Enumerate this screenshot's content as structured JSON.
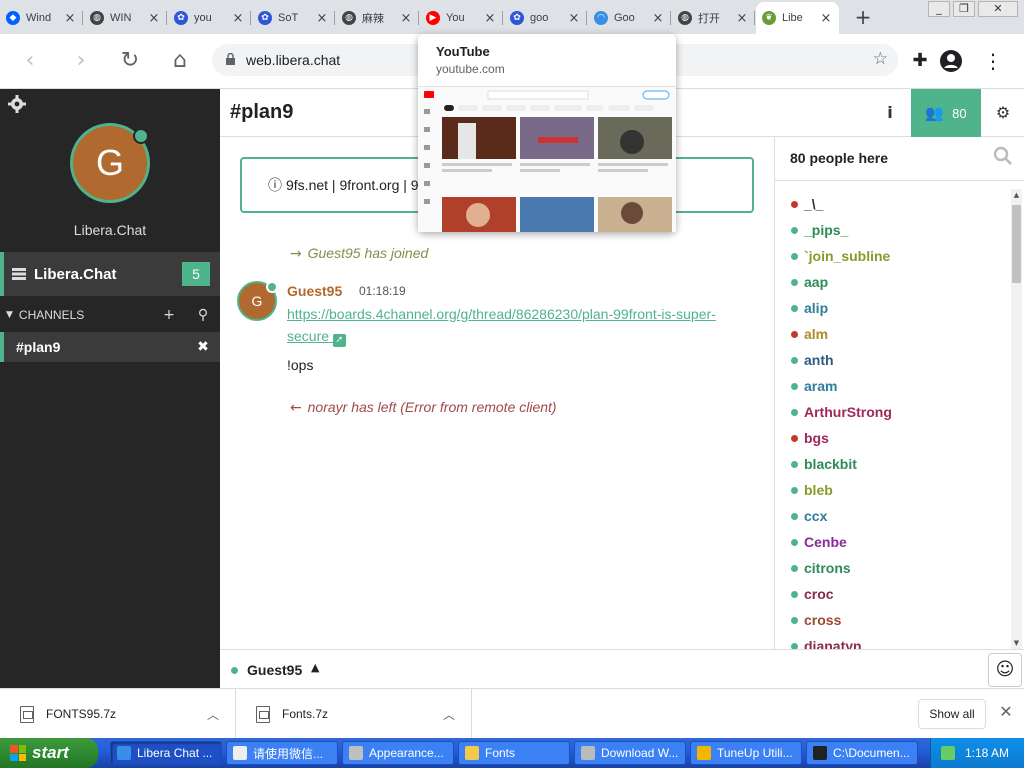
{
  "browser": {
    "tabs": [
      {
        "title": "Wind",
        "icon": "dropbox-icon",
        "color": "#0061fe"
      },
      {
        "title": "WIN",
        "icon": "globe-icon",
        "color": "#444444"
      },
      {
        "title": "you",
        "icon": "baidu-paw-icon",
        "color": "#2f56d9"
      },
      {
        "title": "SoT",
        "icon": "baidu-paw-icon",
        "color": "#2f56d9"
      },
      {
        "title": "麻辣",
        "icon": "globe-icon",
        "color": "#444444"
      },
      {
        "title": "You",
        "icon": "youtube-icon",
        "color": "#ff0000"
      },
      {
        "title": "goo",
        "icon": "baidu-paw-icon",
        "color": "#2f56d9"
      },
      {
        "title": "Goo",
        "icon": "swirl-icon",
        "color": "#3a8ee6"
      },
      {
        "title": "打开",
        "icon": "globe-icon",
        "color": "#444444"
      },
      {
        "title": "Libe",
        "icon": "leaf-icon",
        "color": "#6a9d3a",
        "active": true
      }
    ],
    "url": "web.libera.chat",
    "hovercard": {
      "title": "YouTube",
      "url": "youtube.com"
    }
  },
  "sidebar": {
    "avatar_letter": "G",
    "network_display": "Libera.Chat",
    "network_label": "Libera.Chat",
    "network_badge": "5",
    "channels_header": "CHANNELS",
    "channel": "#plan9"
  },
  "header": {
    "channel": "#plan9",
    "user_count": "80"
  },
  "topic": "9fs.net | 9front.org | 9",
  "messages": {
    "join": {
      "arrow": "→",
      "nick": "Guest95",
      "text": "has joined"
    },
    "msg": {
      "avatar_letter": "G",
      "nick": "Guest95",
      "time": "01:18:19",
      "link": "https://boards.4channel.org/g/thread/86286230/plan-99front-is-super-secure",
      "text2": "!ops"
    },
    "part": {
      "arrow": "←",
      "nick": "norayr",
      "text": "has left (Error from remote client)"
    }
  },
  "users": {
    "header": "80 people here",
    "list": [
      {
        "nick": "_\\_",
        "color": "#333333",
        "dot": "#c0392b"
      },
      {
        "nick": "_pips_",
        "color": "#2e8b57",
        "dot": "#4fb38b"
      },
      {
        "nick": "`join_subline",
        "color": "#8a9a2a",
        "dot": "#4fb38b"
      },
      {
        "nick": "aap",
        "color": "#2e8b57",
        "dot": "#4fb38b"
      },
      {
        "nick": "alip",
        "color": "#2e7d9a",
        "dot": "#4fb38b"
      },
      {
        "nick": "alm",
        "color": "#b0892a",
        "dot": "#c0392b"
      },
      {
        "nick": "anth",
        "color": "#2e5a7d",
        "dot": "#4fb38b"
      },
      {
        "nick": "aram",
        "color": "#2e7d9a",
        "dot": "#4fb38b"
      },
      {
        "nick": "ArthurStrong",
        "color": "#a0285a",
        "dot": "#4fb38b"
      },
      {
        "nick": "bgs",
        "color": "#a0285a",
        "dot": "#c0392b"
      },
      {
        "nick": "blackbit",
        "color": "#2e8b57",
        "dot": "#4fb38b"
      },
      {
        "nick": "bleb",
        "color": "#8a9a2a",
        "dot": "#4fb38b"
      },
      {
        "nick": "ccx",
        "color": "#2e7d9a",
        "dot": "#4fb38b"
      },
      {
        "nick": "Cenbe",
        "color": "#8a2a9a",
        "dot": "#4fb38b"
      },
      {
        "nick": "citrons",
        "color": "#2e8b57",
        "dot": "#4fb38b"
      },
      {
        "nick": "croc",
        "color": "#8a2a4a",
        "dot": "#4fb38b"
      },
      {
        "nick": "cross",
        "color": "#9a4a2a",
        "dot": "#4fb38b"
      },
      {
        "nick": "djanatyn",
        "color": "#8a2a4a",
        "dot": "#4fb38b"
      }
    ]
  },
  "inputbar": {
    "nick": "Guest95"
  },
  "downloads": {
    "items": [
      "FONTS95.7z",
      "Fonts.7z"
    ],
    "show_all": "Show all"
  },
  "taskbar": {
    "start": "start",
    "items": [
      {
        "label": "Libera Chat ...",
        "color": "#3a8ee6",
        "active": true
      },
      {
        "label": "请使用微信...",
        "color": "#eeeeee"
      },
      {
        "label": "Appearance...",
        "color": "#c0c0c0"
      },
      {
        "label": "Fonts",
        "color": "#f2c94c"
      },
      {
        "label": "Download W...",
        "color": "#bbbbbb"
      },
      {
        "label": "TuneUp Utili...",
        "color": "#f2b600"
      },
      {
        "label": "C:\\Documen...",
        "color": "#222222"
      }
    ],
    "clock": "1:18 AM"
  }
}
